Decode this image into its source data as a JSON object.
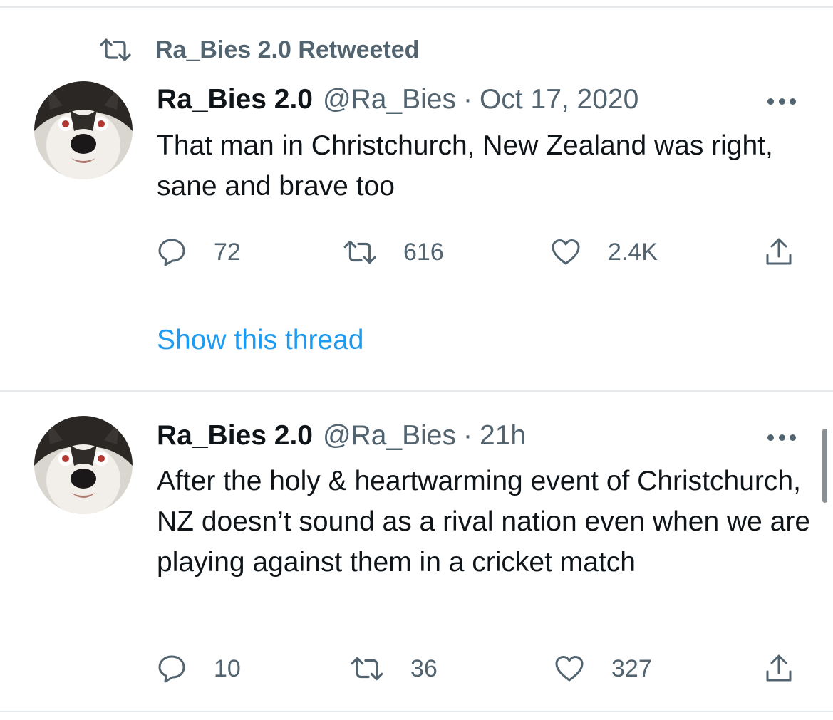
{
  "retweet_banner": {
    "label": "Ra_Bies 2.0 Retweeted",
    "icon": "retweet-icon"
  },
  "tweets": [
    {
      "display_name": "Ra_Bies 2.0",
      "handle": "@Ra_Bies",
      "separator": "·",
      "time": "Oct 17, 2020",
      "text": "That man in Christchurch, New Zealand was right, sane and brave too",
      "replies": "72",
      "retweets": "616",
      "likes": "2.4K",
      "show_thread": "Show this thread"
    },
    {
      "display_name": "Ra_Bies 2.0",
      "handle": "@Ra_Bies",
      "separator": "·",
      "time": "21h",
      "text": "After the holy & heartwarming event of Christchurch, NZ doesn’t sound as a rival nation even when we are playing against them in a cricket match",
      "replies": "10",
      "retweets": "36",
      "likes": "327"
    }
  ],
  "colors": {
    "secondary_text": "#536471",
    "primary_text": "#0f1419",
    "link": "#1d9bf0",
    "divider": "#e6e9eb"
  }
}
